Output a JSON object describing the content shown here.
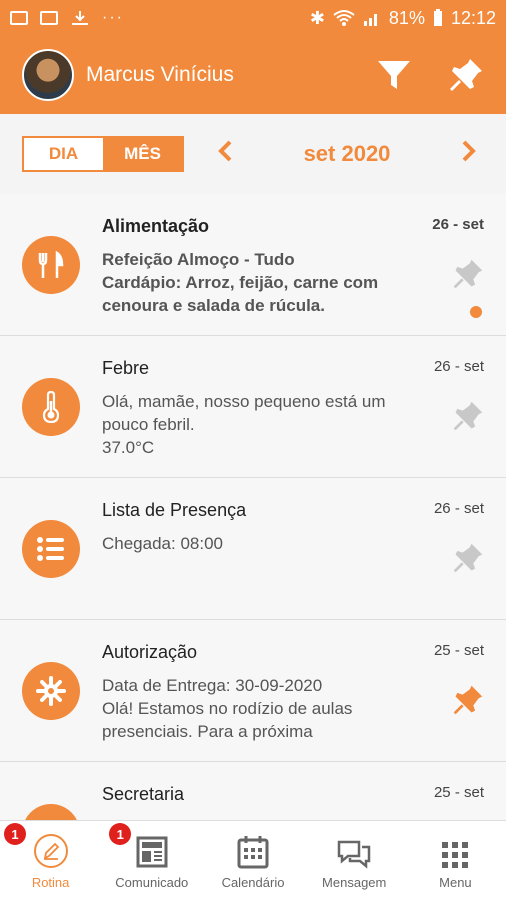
{
  "status_bar": {
    "battery": "81%",
    "time": "12:12",
    "dots": "···"
  },
  "header": {
    "user_name": "Marcus Vinícius",
    "icons": [
      "filter-icon",
      "pin-icon"
    ]
  },
  "period": {
    "toggle_day": "DIA",
    "toggle_month": "MÊS",
    "selected": "MÊS",
    "label": "set 2020"
  },
  "feed": [
    {
      "title": "Alimentação",
      "date": "26 - set",
      "lines": [
        "Refeição Almoço - Tudo",
        "Cardápio: Arroz, feijão, carne com",
        "cenoura e salada de rúcula."
      ],
      "icon": "fork-knife-icon",
      "unread": true,
      "pinned": false
    },
    {
      "title": "Febre",
      "date": "26 - set",
      "lines": [
        "Olá, mamãe, nosso pequeno está um",
        "pouco febril.",
        "37.0°C"
      ],
      "icon": "thermometer-icon",
      "unread": false,
      "pinned": false
    },
    {
      "title": "Lista de Presença",
      "date": "26 - set",
      "lines": [
        "Chegada: 08:00"
      ],
      "icon": "list-icon",
      "unread": false,
      "pinned": false
    },
    {
      "title": "Autorização",
      "date": "25 - set",
      "lines": [
        "Data de Entrega: 30-09-2020",
        "Olá! Estamos no rodízio de aulas",
        "presenciais. Para a próxima"
      ],
      "icon": "gear-icon",
      "unread": false,
      "pinned": true
    },
    {
      "title": "Secretaria",
      "date": "25 - set",
      "lines": [],
      "icon": "secretary-icon",
      "unread": false,
      "pinned": false
    }
  ],
  "bottom_nav": [
    {
      "label": "Rotina",
      "icon": "pencil-icon",
      "badge": "1",
      "active": true
    },
    {
      "label": "Comunicado",
      "icon": "newspaper-icon",
      "badge": "1",
      "active": false
    },
    {
      "label": "Calendário",
      "icon": "calendar-icon",
      "badge": "",
      "active": false
    },
    {
      "label": "Mensagem",
      "icon": "chat-icon",
      "badge": "",
      "active": false
    },
    {
      "label": "Menu",
      "icon": "grid-icon",
      "badge": "",
      "active": false
    }
  ],
  "colors": {
    "accent": "#f18a3c",
    "pin_inactive": "#c8c8c8",
    "badge": "#e0201c"
  }
}
